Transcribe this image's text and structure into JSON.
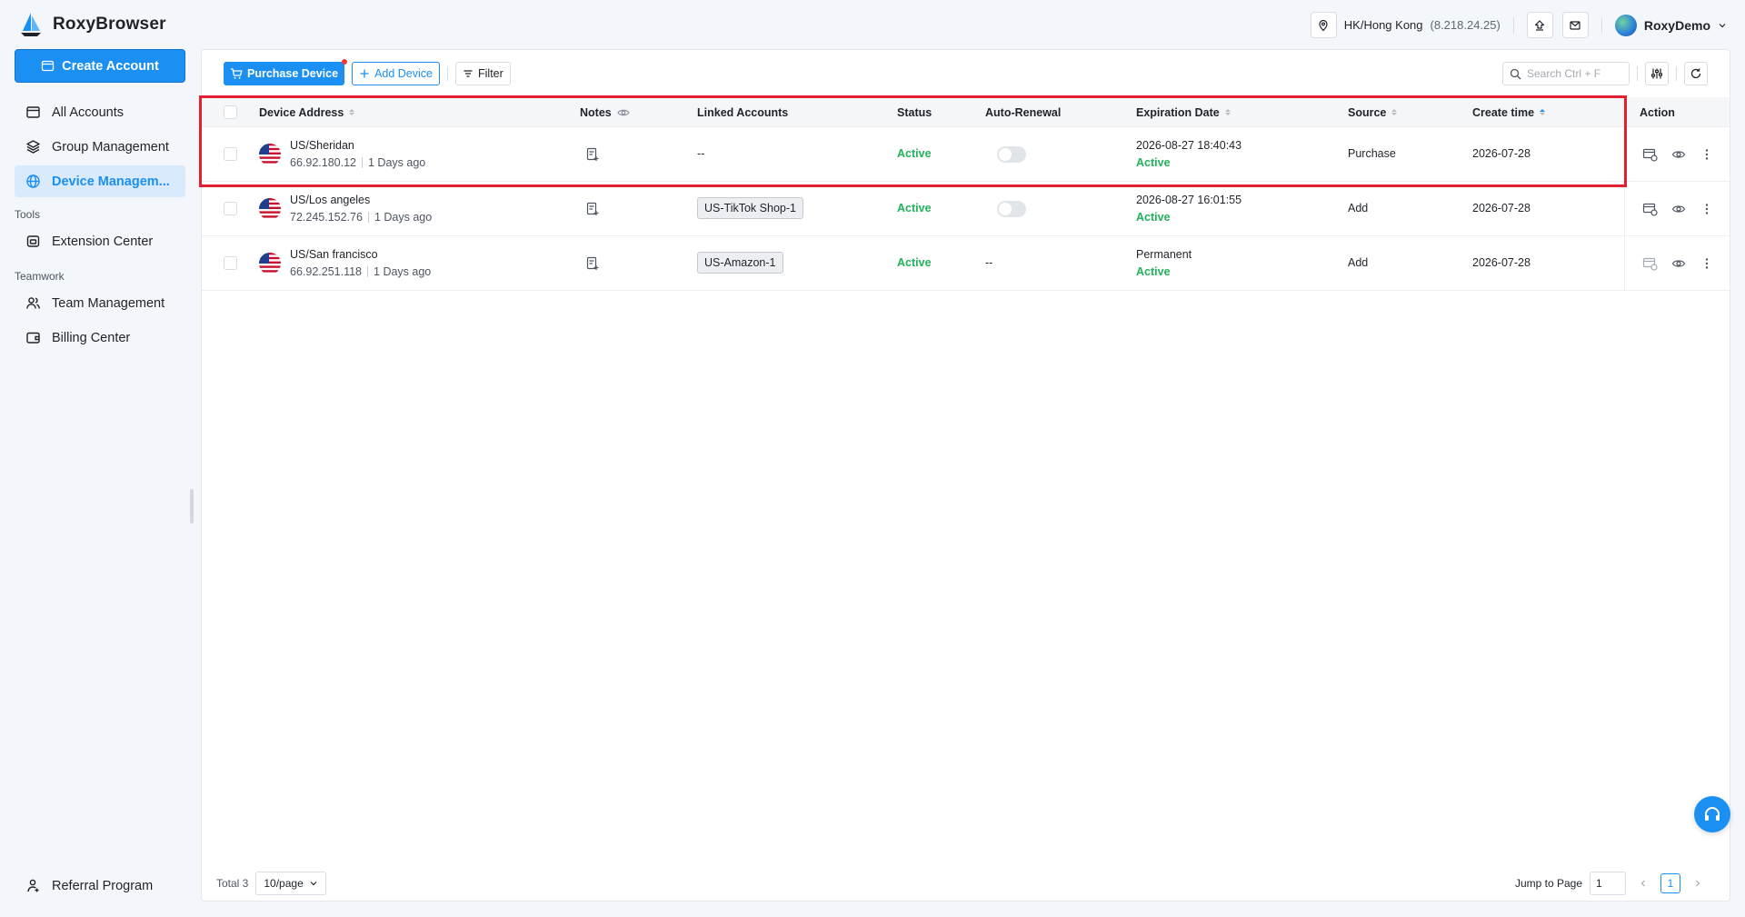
{
  "app": {
    "title": "RoxyBrowser"
  },
  "header": {
    "location": "HK/Hong Kong",
    "location_ip": "(8.218.24.25)",
    "user_name": "RoxyDemo"
  },
  "sidebar": {
    "create_label": "Create Account",
    "items": [
      {
        "label": "All Accounts",
        "icon": "calendar-icon"
      },
      {
        "label": "Group Management",
        "icon": "layers-icon"
      },
      {
        "label": "Device Managem...",
        "icon": "globe-icon",
        "active": true
      }
    ],
    "tools_title": "Tools",
    "tools_items": [
      {
        "label": "Extension Center",
        "icon": "extension-icon"
      }
    ],
    "teamwork_title": "Teamwork",
    "teamwork_items": [
      {
        "label": "Team Management",
        "icon": "team-icon"
      },
      {
        "label": "Billing Center",
        "icon": "wallet-icon"
      }
    ],
    "bottom_item": {
      "label": "Referral Program",
      "icon": "referral-icon"
    }
  },
  "toolbar": {
    "purchase_label": "Purchase Device",
    "add_label": "Add Device",
    "filter_label": "Filter",
    "search_placeholder": "Search Ctrl + F"
  },
  "table": {
    "columns": {
      "device_address": "Device Address",
      "notes": "Notes",
      "linked_accounts": "Linked Accounts",
      "status": "Status",
      "auto_renewal": "Auto-Renewal",
      "expiration_date": "Expiration Date",
      "source": "Source",
      "create_time": "Create time",
      "action": "Action"
    },
    "rows": [
      {
        "location": "US/Sheridan",
        "ip": "66.92.180.12",
        "age": "1 Days ago",
        "linked": "--",
        "linked_is_tag": false,
        "status": "Active",
        "auto_renewal": "toggle-off",
        "expiration": "2026-08-27 18:40:43",
        "expiration_status": "Active",
        "source": "Purchase",
        "create_time": "2026-07-28"
      },
      {
        "location": "US/Los angeles",
        "ip": "72.245.152.76",
        "age": "1 Days ago",
        "linked": "US-TikTok Shop-1",
        "linked_is_tag": true,
        "status": "Active",
        "auto_renewal": "toggle-off",
        "expiration": "2026-08-27 16:01:55",
        "expiration_status": "Active",
        "source": "Add",
        "create_time": "2026-07-28"
      },
      {
        "location": "US/San francisco",
        "ip": "66.92.251.118",
        "age": "1 Days ago",
        "linked": "US-Amazon-1",
        "linked_is_tag": true,
        "status": "Active",
        "auto_renewal": "--",
        "expiration": "Permanent",
        "expiration_status": "Active",
        "source": "Add",
        "create_time": "2026-07-28"
      }
    ]
  },
  "footer": {
    "total": "Total 3",
    "page_size": "10/page",
    "jump_label": "Jump to Page",
    "jump_value": "1",
    "current_page": "1"
  },
  "colors": {
    "accent": "#1b8ff2",
    "active_green": "#21b35a",
    "highlight_red": "#e22130"
  }
}
